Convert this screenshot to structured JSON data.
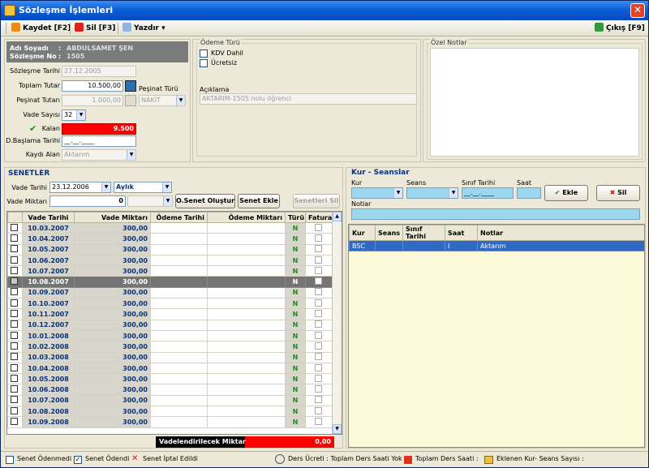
{
  "window": {
    "title": "Sözleşme İşlemleri",
    "close": "✕"
  },
  "toolbar": {
    "save": "Kaydet [F2]",
    "delete": "Sil [F3]",
    "print": "Yazdır",
    "exit": "Çıkış [F9]",
    "print_arrow": "▾"
  },
  "header": {
    "adisoyadi_label": "Adı Soyadı",
    "adisoyadi": "ABDULSAMET ŞEN",
    "sozlesme_label": "Sözleşme No",
    "sozlesme_no": "1505",
    "colon": ":"
  },
  "form": {
    "sozlesme_tarihi_label": "Sözleşme Tarihi",
    "sozlesme_tarihi": "27.12.2005",
    "toplam_tutar_label": "Toplam Tutar",
    "toplam_tutar": "10.500,00",
    "pesinat_turu_label": "Peşinat Türü",
    "pesinat_turu": "NAKİT",
    "pesinat_tutari_label": "Peşinat Tutarı",
    "pesinat_tutari": "1.000,00",
    "vade_sayisi_label": "Vade Sayısı",
    "vade_sayisi": "32",
    "kalan_label": "Kalan",
    "kalan": "9.500",
    "dbaslama_label": "D.Başlama Tarihi",
    "dbaslama": "__.__.____",
    "kaydi_alan_label": "Kaydı Alan",
    "kaydi_alan": "Aktarım"
  },
  "odeme": {
    "title": "Ödeme Türü",
    "kdv": "KDV Dahil",
    "ucretsiz": "Ücretsiz",
    "aciklama_label": "Açıklama",
    "aciklama": "AKTARIM-1505 nolu öğrenci"
  },
  "notes": {
    "title": "Özel Notlar"
  },
  "senetler": {
    "title": "SENETLER",
    "vade_tarihi_label": "Vade Tarihi",
    "vade_tarihi": "23.12.2006",
    "period": "Aylık",
    "vade_miktari_label": "Vade Miktarı",
    "vade_miktari": "0",
    "btn_olustur": "O.Senet Oluştur",
    "btn_ekle": "Senet Ekle",
    "btn_sil": "Senetleri Sil",
    "columns": [
      "Vade Tarihi",
      "Vade Miktarı",
      "Ödeme Tarihi",
      "Ödeme Miktarı",
      "Türü",
      "Fatura"
    ],
    "rows": [
      {
        "date": "10.03.2007",
        "amount": "300,00",
        "type": "N"
      },
      {
        "date": "10.04.2007",
        "amount": "300,00",
        "type": "N"
      },
      {
        "date": "10.05.2007",
        "amount": "300,00",
        "type": "N"
      },
      {
        "date": "10.06.2007",
        "amount": "300,00",
        "type": "N"
      },
      {
        "date": "10.07.2007",
        "amount": "300,00",
        "type": "N"
      },
      {
        "date": "10.08.2007",
        "amount": "300,00",
        "type": "N"
      },
      {
        "date": "10.09.2007",
        "amount": "300,00",
        "type": "N"
      },
      {
        "date": "10.10.2007",
        "amount": "300,00",
        "type": "N"
      },
      {
        "date": "10.11.2007",
        "amount": "300,00",
        "type": "N"
      },
      {
        "date": "10.12.2007",
        "amount": "300,00",
        "type": "N"
      },
      {
        "date": "10.01.2008",
        "amount": "300,00",
        "type": "N"
      },
      {
        "date": "10.02.2008",
        "amount": "300,00",
        "type": "N"
      },
      {
        "date": "10.03.2008",
        "amount": "300,00",
        "type": "N"
      },
      {
        "date": "10.04.2008",
        "amount": "300,00",
        "type": "N"
      },
      {
        "date": "10.05.2008",
        "amount": "300,00",
        "type": "N"
      },
      {
        "date": "10.06.2008",
        "amount": "300,00",
        "type": "N"
      },
      {
        "date": "10.07.2008",
        "amount": "300,00",
        "type": "N"
      },
      {
        "date": "10.08.2008",
        "amount": "300,00",
        "type": "N"
      },
      {
        "date": "10.09.2008",
        "amount": "300,00",
        "type": "N"
      }
    ],
    "selected_row": 5,
    "vadelendirilecek_label": "Vadelendirilecek Miktar",
    "vadelendirilecek": "0,00"
  },
  "kur": {
    "title": "Kur - Seanslar",
    "kur_label": "Kur",
    "seans_label": "Seans",
    "sinif_label": "Sınıf Tarihi",
    "sinif_value": "__.__.____",
    "saat_label": "Saat",
    "notlar_label": "Notlar",
    "btn_ekle": "Ekle",
    "btn_sil": "Sil",
    "columns": [
      "Kur",
      "Seans",
      "Sınıf Tarihi",
      "Saat",
      "Notlar"
    ],
    "rows": [
      {
        "kur": "BSC",
        "seans": "",
        "sinif": "",
        "saat": "I",
        "notlar": "Aktarım"
      }
    ]
  },
  "status": {
    "odenmedi": "Senet Ödenmedi",
    "odendi": "Senet Ödendi",
    "iptal": "Senet İptal Edildi",
    "ders_ucreti": "Ders Ücreti : Toplam Ders Saati Yok",
    "toplam_ders": "Toplam Ders Saati :",
    "eklenen": "Eklenen Kur- Seans Sayısı :"
  },
  "colors": {
    "title_bar": "#0a5fd8",
    "kalan_red": "#ff0000",
    "selected_row": "#747474",
    "kur_selected": "#316ac5",
    "header_gray": "#7b7b7b"
  }
}
